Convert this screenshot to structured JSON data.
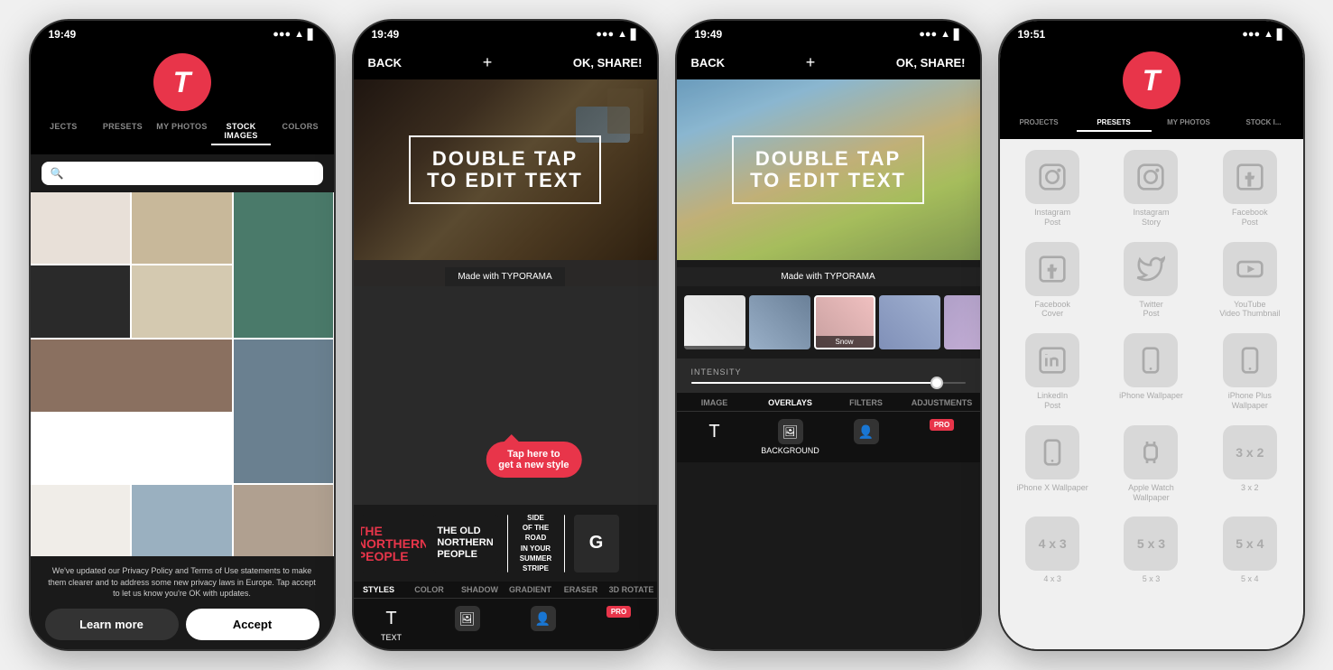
{
  "phone1": {
    "status_time": "19:49",
    "nav_tabs": [
      "JECTS",
      "PRESETS",
      "MY PHOTOS",
      "STOCK IMAGES",
      "COLORS"
    ],
    "active_tab": "STOCK IMAGES",
    "search_placeholder": "",
    "privacy_text": "We've updated our Privacy Policy and Terms of Use statements to make them clearer and to address some new privacy laws in Europe. Tap accept to let us know you're OK with updates.",
    "btn_learn": "Learn more",
    "btn_accept": "Accept"
  },
  "phone2": {
    "status_time": "19:49",
    "back_label": "BACK",
    "plus_label": "+",
    "ok_label": "OK, SHARE!",
    "main_text_line1": "DOUBLE TAP",
    "main_text_line2": "TO EDIT TEXT",
    "made_with": "Made with TYPORAMA",
    "tap_bubble": "Tap here to\nget a new style",
    "styles_label": "STYLES",
    "color_label": "COLOR",
    "shadow_label": "SHADOW",
    "gradient_label": "GRADIENT",
    "eraser_label": "ERASER",
    "rotate_label": "3D ROTATE",
    "text_tab": "TEXT",
    "pro_label": "PRO"
  },
  "phone3": {
    "status_time": "19:49",
    "back_label": "BACK",
    "plus_label": "+",
    "ok_label": "OK, SHARE!",
    "main_text_line1": "DOUBLE TAP",
    "main_text_line2": "TO EDIT TEXT",
    "made_with": "Made with TYPORAMA",
    "image_tab": "IMAGE",
    "overlays_tab": "OVERLAYS",
    "filters_tab": "FILTERS",
    "adjustments_tab": "ADJUSTMENTS",
    "intensity_label": "INTENSITY",
    "overlay_snow": "Snow",
    "background_tab": "BACKGROUND",
    "pro_label": "PRO"
  },
  "phone4": {
    "status_time": "19:51",
    "nav_tabs": [
      "PROJECTS",
      "PRESETS",
      "MY PHOTOS",
      "STOCK I..."
    ],
    "active_tab": "PRESETS",
    "presets": [
      {
        "label": "Instagram\nPost",
        "icon": "instagram"
      },
      {
        "label": "Instagram\nStory",
        "icon": "instagram"
      },
      {
        "label": "Facebook\nPost",
        "icon": "facebook"
      }
    ],
    "presets2": [
      {
        "label": "Facebook\nCover",
        "icon": "facebook"
      },
      {
        "label": "Twitter\nPost",
        "icon": "twitter"
      },
      {
        "label": "YouTube\nVideo Thumbnail",
        "icon": "youtube"
      }
    ],
    "presets3": [
      {
        "label": "LinkedIn\nPost",
        "icon": "linkedin"
      },
      {
        "label": "iPhone Wallpaper",
        "icon": "phone"
      },
      {
        "label": "iPhone Plus Wallpaper",
        "icon": "phone"
      }
    ],
    "presets4": [
      {
        "label": "iPhone X Wallpaper",
        "icon": "phone"
      },
      {
        "label": "Apple Watch Wallpaper",
        "icon": "watch"
      },
      {
        "label": "3 x 2",
        "size": "3 x 2"
      }
    ],
    "presets5": [
      {
        "label": "4 x 3",
        "size": "4 x 3"
      },
      {
        "label": "5 x 3",
        "size": "5 x 3"
      },
      {
        "label": "5 x 4",
        "size": "5 x 4"
      }
    ]
  }
}
